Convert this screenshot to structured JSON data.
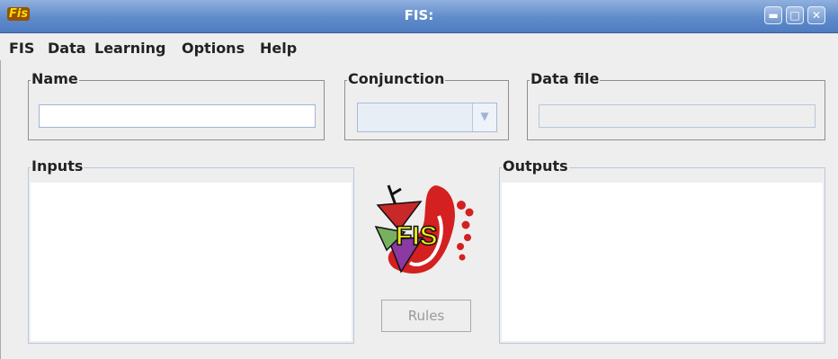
{
  "window": {
    "title": "FIS:",
    "icon": "fis-app-icon",
    "icon_label": "Fis",
    "minimize_icon": "minimize-icon",
    "maximize_icon": "maximize-icon",
    "close_icon": "close-icon"
  },
  "menu": {
    "items": [
      {
        "label": "FIS"
      },
      {
        "label": "Data"
      },
      {
        "label": "Learning"
      },
      {
        "label": "Options"
      },
      {
        "label": "Help"
      }
    ]
  },
  "name_group": {
    "label": "Name",
    "value": ""
  },
  "conjunction_group": {
    "label": "Conjunction",
    "selected": "",
    "icon": "chevron-down-icon"
  },
  "data_file_group": {
    "label": "Data file",
    "value": ""
  },
  "inputs_group": {
    "label": "Inputs",
    "items": []
  },
  "outputs_group": {
    "label": "Outputs",
    "items": []
  },
  "logo": {
    "text": "FIS",
    "icon": "fis-logo"
  },
  "rules_button": {
    "label": "Rules",
    "enabled": false
  },
  "colors": {
    "titlebar": "#5f8bcb",
    "field_border": "#9db6d4",
    "logo_red": "#d42020",
    "logo_yellow": "#f0ea18",
    "logo_purple": "#8a3aa0"
  }
}
